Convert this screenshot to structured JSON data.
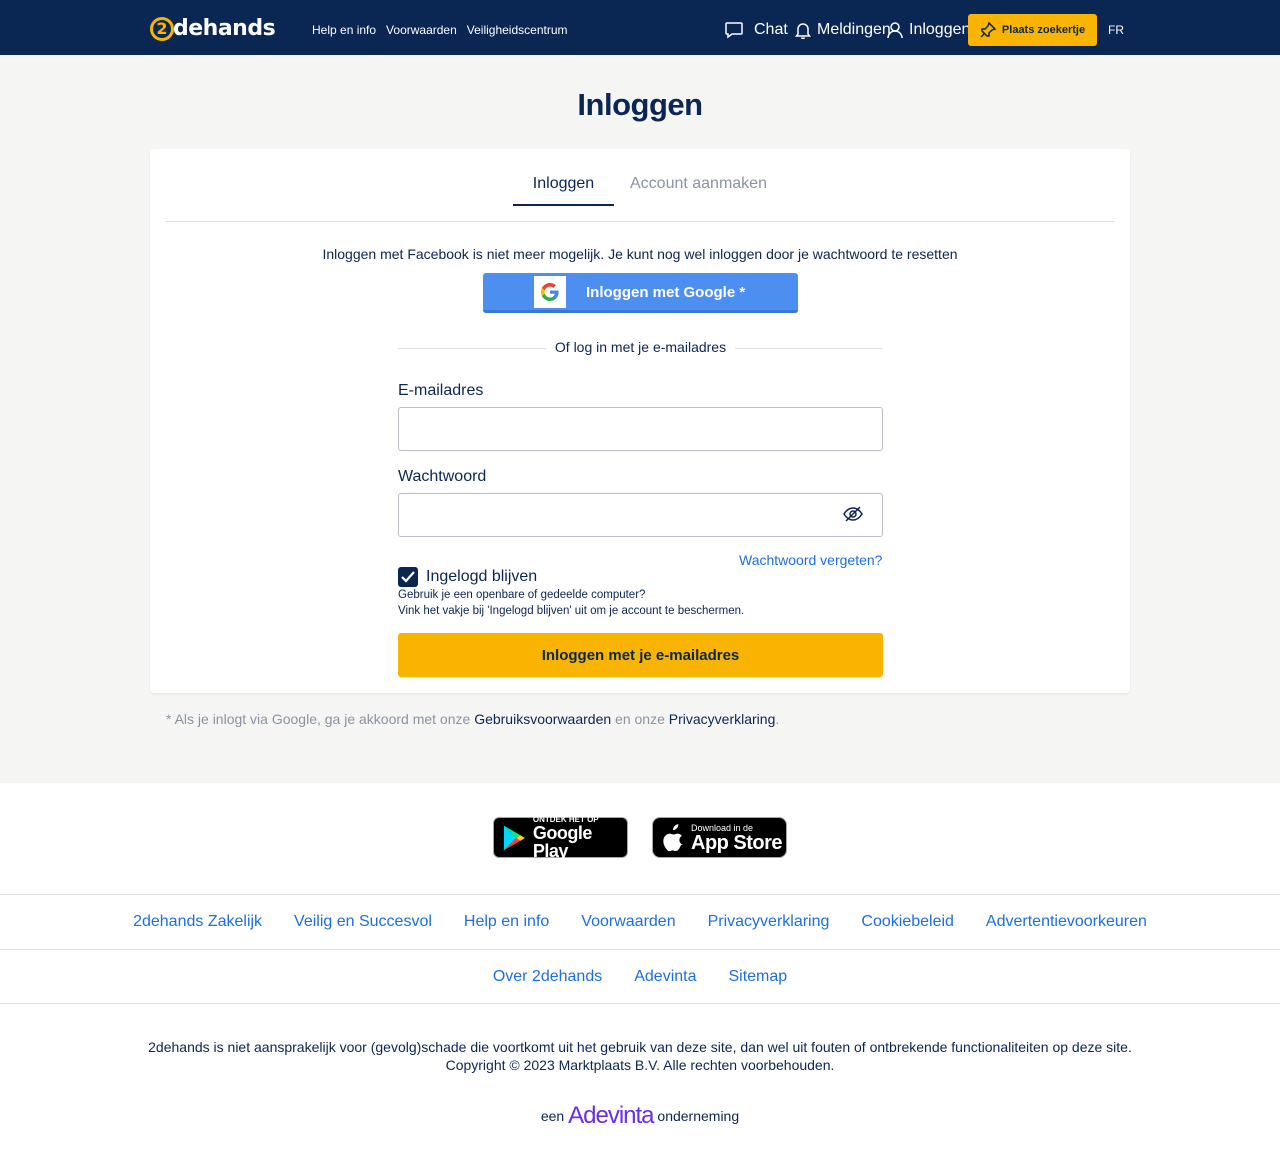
{
  "header": {
    "logo_number": "2",
    "logo_text": "dehands",
    "nav": [
      "Help en info",
      "Voorwaarden",
      "Veiligheidscentrum"
    ],
    "chat": "Chat",
    "notifications": "Meldingen",
    "login": "Inloggen",
    "place_ad": "Plaats zoekertje",
    "language": "FR"
  },
  "page": {
    "title": "Inloggen",
    "tabs": [
      "Inloggen",
      "Account aanmaken"
    ],
    "facebook_note": "Inloggen met Facebook is niet meer mogelijk. Je kunt nog wel inloggen door je",
    "facebook_link": "wachtwoord te resetten",
    "google_button": "Inloggen met Google *",
    "divider": "Of log in met je e-mailadres",
    "email_label": "E-mailadres",
    "email_value": "",
    "password_label": "Wachtwoord",
    "password_value": "",
    "forgot": "Wachtwoord vergeten?",
    "remember_label": "Ingelogd blijven",
    "remember_checked": true,
    "help_line1": "Gebruik je een openbare of gedeelde computer?",
    "help_line2": "Vink het vakje bij 'Ingelogd blijven' uit om je account te beschermen.",
    "submit": "Inloggen met je e-mailadres",
    "terms_prefix": "* Als je inlogt via Google, ga je akkoord met onze",
    "terms_link1": "Gebruiksvoorwaarden",
    "terms_middle": "en onze",
    "terms_link2": "Privacyverklaring",
    "terms_suffix": "."
  },
  "footer": {
    "google_play_small": "ONTDEK HET OP",
    "google_play_big": "Google Play",
    "app_store_small": "Download in de",
    "app_store_big": "App Store",
    "links_row1": [
      "2dehands Zakelijk",
      "Veilig en Succesvol",
      "Help en info",
      "Voorwaarden",
      "Privacyverklaring",
      "Cookiebeleid",
      "Advertentievoorkeuren"
    ],
    "links_row2": [
      "Over 2dehands",
      "Adevinta",
      "Sitemap"
    ],
    "disclaimer_line1": "2dehands is niet aansprakelijk voor (gevolg)schade die voortkomt uit het gebruik van deze site, dan wel uit fouten of ontbrekende functionaliteiten op deze site.",
    "disclaimer_line2": "Copyright © 2023 Marktplaats B.V. Alle rechten voorbehouden.",
    "company_prefix": "een",
    "company_brand": "Adevinta",
    "company_suffix": "onderneming"
  },
  "colors": {
    "header_bg": "#0a2652",
    "accent_yellow": "#f8b400",
    "google_blue": "#4d8ef1",
    "link_blue": "#1d6fe0",
    "adevinta_purple": "#6a2de6"
  }
}
